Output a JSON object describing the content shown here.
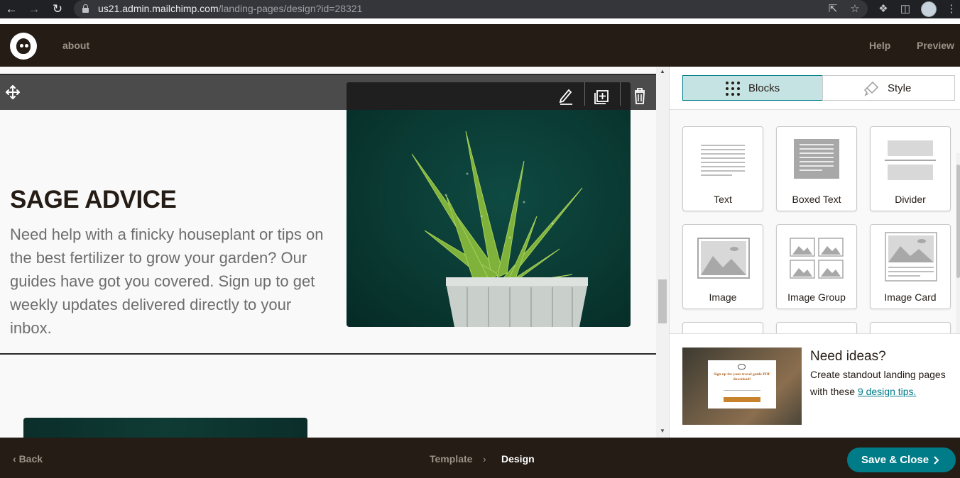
{
  "browser": {
    "url_host": "us21.admin.mailchimp.com",
    "url_path": "/landing-pages/design?id=28321"
  },
  "header": {
    "page_name": "about",
    "help_label": "Help",
    "preview_label": "Preview"
  },
  "content": {
    "section_title": "SAGE ADVICE",
    "section_body": "Need help with a finicky houseplant or tips on the best fertilizer to grow your garden? Our guides have got you covered. Sign up to get weekly updates delivered directly to your inbox."
  },
  "panel": {
    "tabs": [
      {
        "label": "Blocks",
        "icon": "grid-icon",
        "active": true
      },
      {
        "label": "Style",
        "icon": "paint-roller-icon",
        "active": false
      }
    ],
    "blocks": [
      {
        "label": "Text"
      },
      {
        "label": "Boxed Text"
      },
      {
        "label": "Divider"
      },
      {
        "label": "Image"
      },
      {
        "label": "Image Group"
      },
      {
        "label": "Image Card"
      }
    ],
    "ideas": {
      "title": "Need ideas?",
      "text": "Create standout landing pages with these",
      "link": "9 design tips.",
      "image_caption": "Sign up for your travel guide PDF download!"
    }
  },
  "footer": {
    "back_label": "Back",
    "steps": [
      "Template",
      "Design"
    ],
    "active_step": "Design",
    "save_label": "Save & Close"
  },
  "colors": {
    "header_bg": "#241c15",
    "accent": "#007c89",
    "active_tab_bg": "#c6e3e4"
  }
}
